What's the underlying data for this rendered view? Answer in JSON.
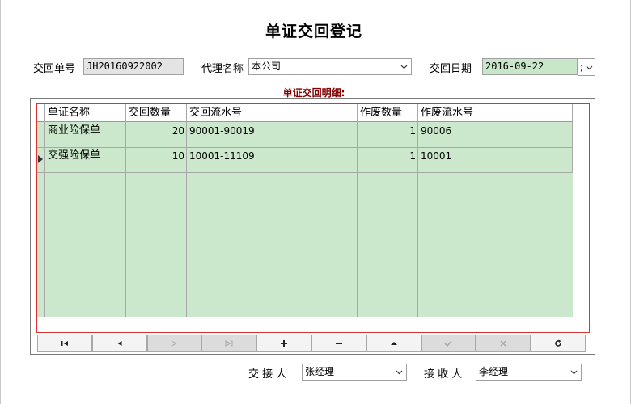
{
  "form": {
    "title": "单证交回登记",
    "return_no_label": "交回单号",
    "return_no_value": "JH20160922002",
    "agent_label": "代理名称",
    "agent_value": "本公司",
    "date_label": "交回日期",
    "date_value": "2016-09-22",
    "date_separator": ";",
    "detail_title": "单证交回明细:"
  },
  "table": {
    "columns": [
      "单证名称",
      "交回数量",
      "交回流水号",
      "作废数量",
      "作废流水号"
    ],
    "rows": [
      {
        "name": "商业险保单",
        "qty": "20",
        "serial": "90001-90019",
        "void_qty": "1",
        "void_serial": "90006"
      },
      {
        "name": "交强险保单",
        "qty": "10",
        "serial": "10001-11109",
        "void_qty": "1",
        "void_serial": "10001"
      }
    ]
  },
  "navigator": [
    {
      "name": "first-record-button",
      "icon": "first-icon",
      "enabled": true
    },
    {
      "name": "prior-record-button",
      "icon": "prior-icon",
      "enabled": true
    },
    {
      "name": "next-record-button",
      "icon": "next-icon",
      "enabled": false
    },
    {
      "name": "last-record-button",
      "icon": "last-icon",
      "enabled": false
    },
    {
      "name": "insert-record-button",
      "icon": "plus-icon",
      "enabled": true
    },
    {
      "name": "delete-record-button",
      "icon": "minus-icon",
      "enabled": true
    },
    {
      "name": "edit-record-button",
      "icon": "up-icon",
      "enabled": true
    },
    {
      "name": "post-record-button",
      "icon": "check-icon",
      "enabled": false
    },
    {
      "name": "cancel-record-button",
      "icon": "x-icon",
      "enabled": false
    },
    {
      "name": "refresh-record-button",
      "icon": "refresh-icon",
      "enabled": true
    }
  ],
  "footer": {
    "handover_label": "交 接 人",
    "handover_value": "张经理",
    "receiver_label": "接 收 人",
    "receiver_value": "李经理"
  }
}
